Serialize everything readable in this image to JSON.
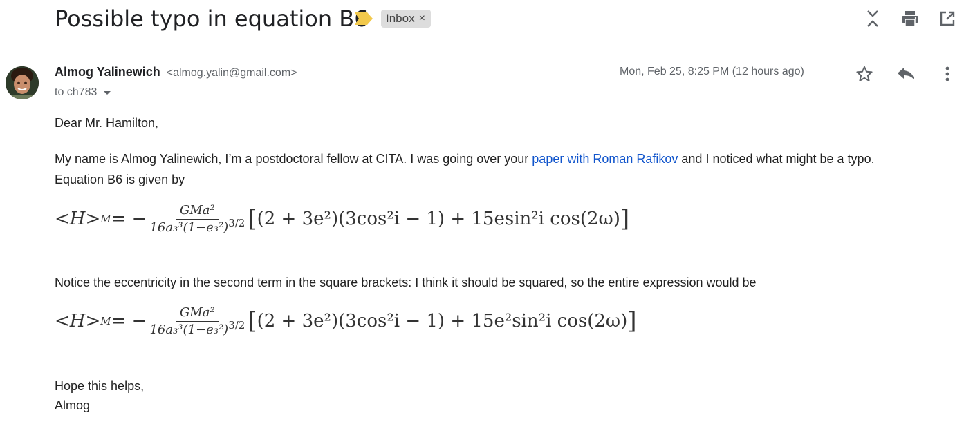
{
  "email": {
    "subject": "Possible typo in equation B6",
    "label": "Inbox",
    "label_remove": "×",
    "sender_name": "Almog Yalinewich",
    "sender_email": "<almog.yalin@gmail.com>",
    "recipient": "to ch783",
    "date": "Mon, Feb 25, 8:25 PM (12 hours ago)",
    "greeting": "Dear Mr. Hamilton,",
    "para1_before_link": "My name is Almog Yalinewich, I’m a postdoctoral fellow at CITA. I was going over your ",
    "para1_link": "paper with Roman Rafikov",
    "para1_after_link": " and I noticed what might be a typo.",
    "para1_line2": "Equation B6 is given by",
    "para2": "Notice the eccentricity in the second term in the square brackets: I think it should be squared, so the entire expression would be",
    "closing": "Hope this helps,",
    "signature": "Almog"
  },
  "equations": {
    "lhs": "<H>",
    "lhs_sub": "M",
    "eq_sign": " = −",
    "numerator": "GMa²",
    "denominator": "16a₃³(1−e₃²)",
    "den_power": "3/2",
    "eq1_body": "(2 + 3e²)(3cos²i − 1) + 15esin²i cos(2ω)",
    "eq2_body": "(2 + 3e²)(3cos²i − 1) + 15e²sin²i cos(2ω)"
  },
  "icons": {
    "important": "important-marker-icon",
    "expand": "expand-collapse-icon",
    "print": "print-icon",
    "open_new": "open-in-new-window-icon",
    "star": "star-icon",
    "reply": "reply-icon",
    "more": "more-vert-icon"
  },
  "colors": {
    "important_marker": "#f2c94c",
    "link": "#1155cc",
    "chip_bg": "#dddddd",
    "muted": "#5f6368"
  }
}
